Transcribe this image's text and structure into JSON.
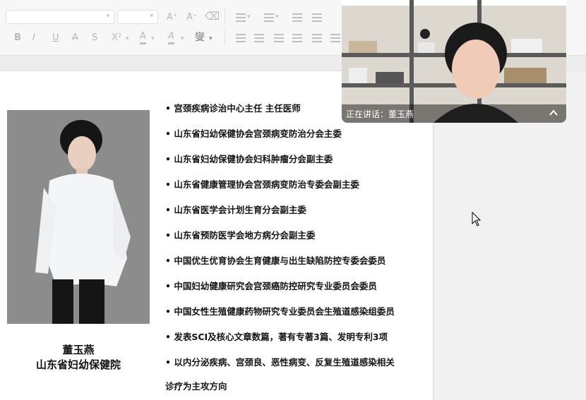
{
  "toolbar": {
    "font_size_placeholder": "",
    "bold": "B",
    "italic": "I",
    "underline": "U",
    "strike": "A",
    "strike2": "S",
    "superscript": "X²",
    "font_color": "A",
    "highlight": "A",
    "phonetic": "燮",
    "grow_font": "A⁺",
    "shrink_font": "A⁻"
  },
  "profile": {
    "name": "董玉燕",
    "org": "山东省妇幼保健院"
  },
  "bullets": [
    "•   宫颈疾病诊治中心主任  主任医师",
    "•  山东省妇幼保健协会宫颈病变防治分会主委",
    "•   山东省妇幼保健协会妇科肿瘤分会副主委",
    "•  山东省健康管理协会宫颈病变防治专委会副主委",
    "•  山东省医学会计划生育分会副主委",
    "•  山东省预防医学会地方病分会副主委",
    "•  中国优生优育协会生育健康与出生缺陷防控专委会委员",
    "•  中国妇幼健康研究会宫颈癌防控研究专业委员会委员",
    "•  中国女性生殖健康药物研究专业委员会生殖道感染组委员",
    "•   发表SCI及核心文章数篇，著有专著3篇、发明专利3项",
    "•   以内分泌疾病、宫颈良、恶性病变、反复生殖道感染相关",
    "    诊疗为主攻方向"
  ],
  "video": {
    "speaking_label": "正在讲话：董玉燕",
    "collapse_icon": "chevron-up-icon"
  },
  "colors": {
    "toolbar_bg": "#f7f7f7",
    "photo_bg": "#8f8f8f",
    "video_overlay": "#000000"
  }
}
